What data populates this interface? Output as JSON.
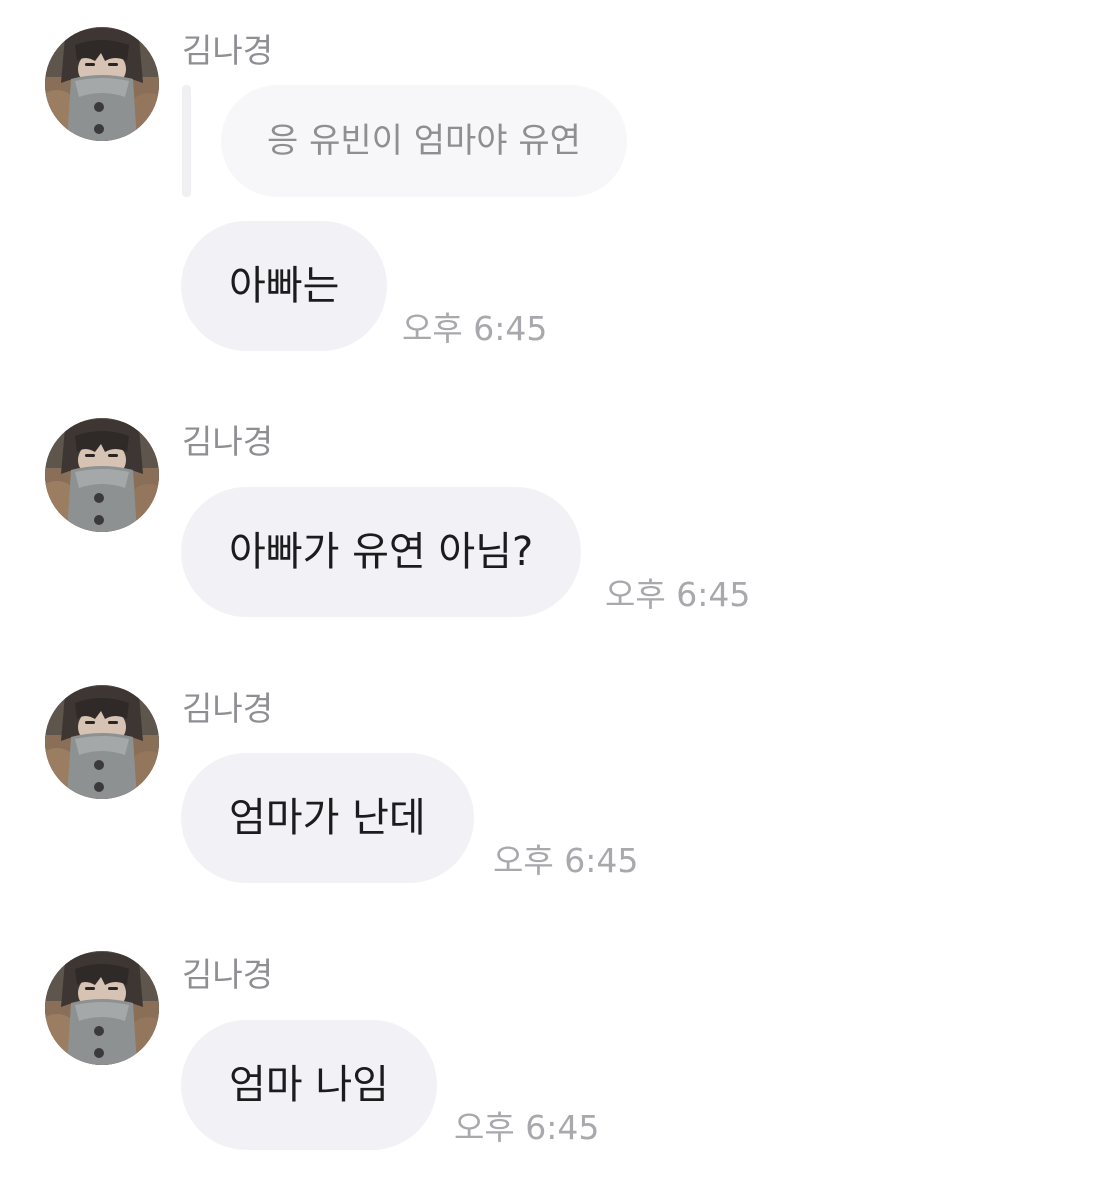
{
  "sender_name": "김나경",
  "messages": [
    {
      "reply_text": "응 유빈이 엄마야 유연",
      "text": "아빠는",
      "time": "오후 6:45"
    },
    {
      "text": "아빠가 유연 아님?",
      "time": "오후 6:45"
    },
    {
      "text": "엄마가 난데",
      "time": "오후 6:45"
    },
    {
      "text": "엄마 나임",
      "time": "오후 6:45"
    }
  ],
  "colors": {
    "bubble": "#f2f2f6",
    "reply_bubble": "#f7f7f9",
    "sender": "#8e8e93",
    "time": "#a8a8ad",
    "text": "#1c1c1e"
  }
}
